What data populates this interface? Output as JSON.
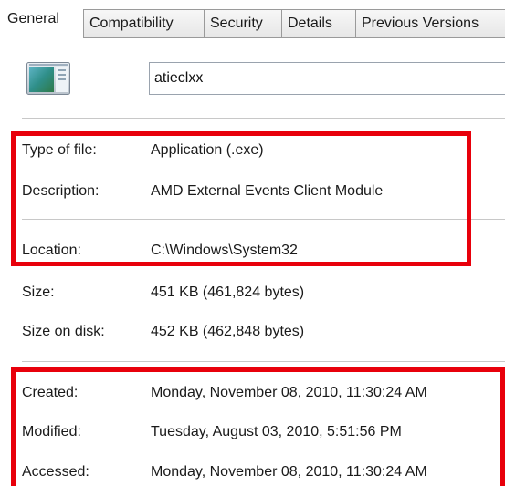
{
  "tabs": [
    {
      "label": "General",
      "active": true
    },
    {
      "label": "Compatibility",
      "active": false
    },
    {
      "label": "Security",
      "active": false
    },
    {
      "label": "Details",
      "active": false
    },
    {
      "label": "Previous Versions",
      "active": false
    }
  ],
  "file": {
    "icon": "application-window-icon",
    "name": "atieclxx"
  },
  "props": {
    "type": {
      "label": "Type of file:",
      "value": "Application (.exe)"
    },
    "description": {
      "label": "Description:",
      "value": "AMD External Events Client Module"
    },
    "location": {
      "label": "Location:",
      "value": "C:\\Windows\\System32"
    },
    "size": {
      "label": "Size:",
      "value": "451 KB (461,824 bytes)"
    },
    "size_on_disk": {
      "label": "Size on disk:",
      "value": "452 KB (462,848 bytes)"
    },
    "created": {
      "label": "Created:",
      "value": "Monday, November 08, 2010, 11:30:24 AM"
    },
    "modified": {
      "label": "Modified:",
      "value": "Tuesday, August 03, 2010, 5:51:56 PM"
    },
    "accessed": {
      "label": "Accessed:",
      "value": "Monday, November 08, 2010, 11:30:24 AM"
    }
  },
  "colors": {
    "highlight": "#e8000b",
    "separator": "#c8c8c8"
  }
}
